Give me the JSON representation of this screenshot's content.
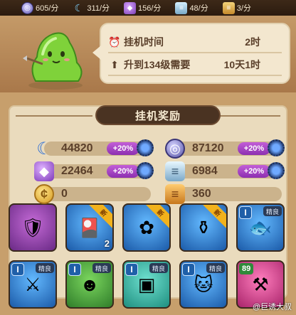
{
  "topbar": {
    "resources": [
      {
        "icon": "silver-coin-icon",
        "label": "605/分"
      },
      {
        "icon": "moon-icon",
        "label": "311/分"
      },
      {
        "icon": "potion-icon",
        "label": "156/分"
      },
      {
        "icon": "scroll-icon",
        "label": "48/分"
      },
      {
        "icon": "scroll-gold-icon",
        "label": "3/分"
      }
    ]
  },
  "info": {
    "idle_time_label": "挂机时间",
    "idle_time_value": "2时",
    "levelup_label": "升到134级需要",
    "levelup_value": "10天1时"
  },
  "rewards": {
    "title": "挂机奖励",
    "items": [
      {
        "icon": "moon-icon",
        "value": "44820",
        "bonus": "+20%"
      },
      {
        "icon": "silver-coin-icon",
        "value": "87120",
        "bonus": "+20%"
      },
      {
        "icon": "potion-icon",
        "value": "22464",
        "bonus": "+20%"
      },
      {
        "icon": "scroll-icon",
        "value": "6984",
        "bonus": "+20%"
      },
      {
        "icon": "gold-coin-icon",
        "value": "0"
      },
      {
        "icon": "scroll-gold-icon",
        "value": "360"
      }
    ]
  },
  "cards": [
    {
      "name": "dark-armor-card",
      "badge": "",
      "qty": ""
    },
    {
      "name": "rune-bundle-card",
      "badge": "新",
      "qty": "2"
    },
    {
      "name": "flower-card",
      "badge": "新",
      "qty": ""
    },
    {
      "name": "cauldron-card",
      "badge": "新",
      "qty": ""
    },
    {
      "name": "fish-hero-card",
      "rank": "I",
      "quality": "精良"
    },
    {
      "name": "knight-hero-card",
      "rank": "I",
      "quality": "精良"
    },
    {
      "name": "slime-hero-card",
      "rank": "I",
      "quality": "精良"
    },
    {
      "name": "cube-hero-card",
      "rank": "I",
      "quality": "精良"
    },
    {
      "name": "cat-hero-card",
      "rank": "I",
      "quality": "精良"
    },
    {
      "name": "pink-weapon-card",
      "level": "89"
    }
  ],
  "watermark": "@巨诱大叔",
  "colors": {
    "bonus": "#a842c8",
    "panel": "#f3e7cf",
    "frame": "#c79f6c"
  }
}
